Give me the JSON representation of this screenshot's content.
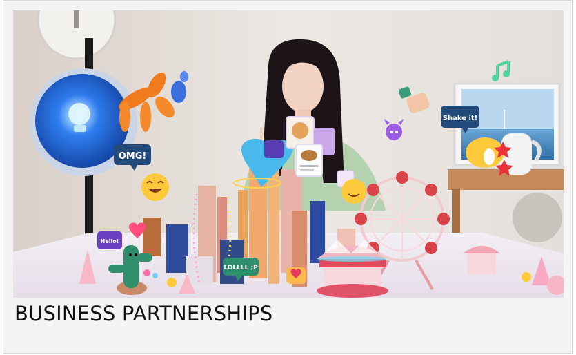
{
  "card": {
    "caption": "BUSINESS PARTNERSHIPS"
  },
  "hero": {
    "stickers": {
      "omg": "OMG!",
      "hello": "Hello!",
      "shake": "Shake it!",
      "lol": "LOLLLL ;P"
    },
    "colors": {
      "wall": "#e7e2dd",
      "table": "#f1ecf2",
      "orb_blue": "#1f63d8",
      "balloon_orange": "#f07a1c",
      "heart_blue": "#45b6e8",
      "sticker_navy": "#234a7a",
      "sticker_purple": "#6a3fc0",
      "sticker_green": "#2f8f6c",
      "ferris_red": "#d8434a"
    }
  }
}
